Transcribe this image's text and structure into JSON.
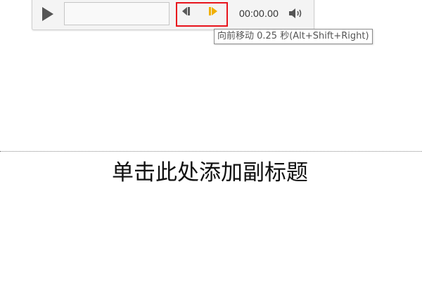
{
  "media_player": {
    "time": "00:00.00",
    "icons": {
      "play": "play-icon",
      "step_back": "step-back-icon",
      "step_forward": "step-forward-icon",
      "volume": "volume-icon"
    },
    "colors": {
      "highlight_border": "#e8141c",
      "step_forward_accent": "#f0b000"
    }
  },
  "tooltip": {
    "text": "向前移动 0.25 秒(Alt+Shift+Right)"
  },
  "slide": {
    "subtitle_placeholder": "单击此处添加副标题"
  }
}
